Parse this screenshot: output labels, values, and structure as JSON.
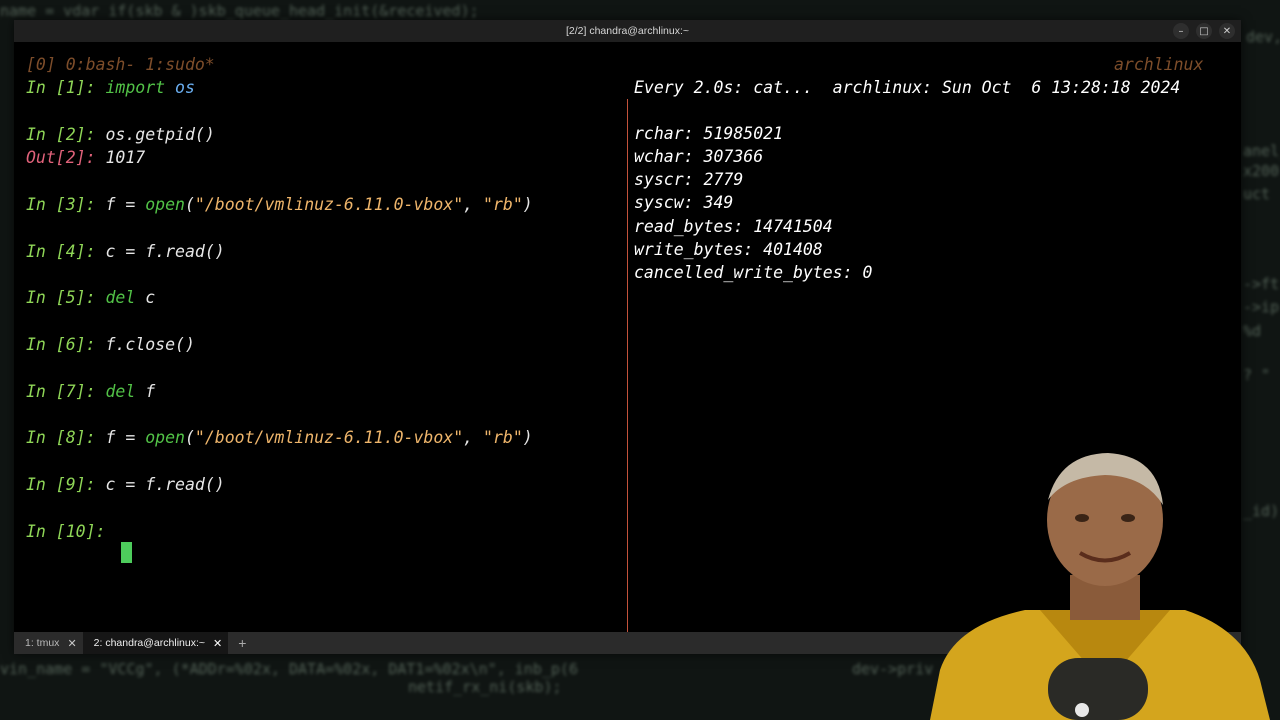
{
  "window": {
    "title": "[2/2] chandra@archlinux:~",
    "controls": [
      "minimize-icon",
      "maximize-icon",
      "close-icon"
    ]
  },
  "tmux": {
    "windows_status": "[0] 0:bash- 1:sudo*",
    "hostname": "archlinux"
  },
  "ipython": [
    {
      "prompt": "In [1]:",
      "code": [
        [
          "kw",
          "import"
        ],
        [
          "plain",
          " "
        ],
        [
          "mod",
          "os"
        ]
      ]
    },
    {
      "prompt": "In [2]:",
      "code": [
        [
          "plain",
          "os.getpid()"
        ]
      ]
    },
    {
      "prompt": "Out[2]:",
      "output": "1017"
    },
    {
      "prompt": "In [3]:",
      "code": [
        [
          "plain",
          "f = "
        ],
        [
          "bi",
          "open"
        ],
        [
          "plain",
          "("
        ],
        [
          "str",
          "\"/boot/vmlinuz-6.11.0-vbox\""
        ],
        [
          "plain",
          ", "
        ],
        [
          "str",
          "\"rb\""
        ],
        [
          "plain",
          ")"
        ]
      ]
    },
    {
      "prompt": "In [4]:",
      "code": [
        [
          "plain",
          "c = f.read()"
        ]
      ]
    },
    {
      "prompt": "In [5]:",
      "code": [
        [
          "kw",
          "del"
        ],
        [
          "plain",
          " c"
        ]
      ]
    },
    {
      "prompt": "In [6]:",
      "code": [
        [
          "plain",
          "f.close()"
        ]
      ]
    },
    {
      "prompt": "In [7]:",
      "code": [
        [
          "kw",
          "del"
        ],
        [
          "plain",
          " f"
        ]
      ]
    },
    {
      "prompt": "In [8]:",
      "code": [
        [
          "plain",
          "f = "
        ],
        [
          "bi",
          "open"
        ],
        [
          "plain",
          "("
        ],
        [
          "str",
          "\"/boot/vmlinuz-6.11.0-vbox\""
        ],
        [
          "plain",
          ", "
        ],
        [
          "str",
          "\"rb\""
        ],
        [
          "plain",
          ")"
        ]
      ]
    },
    {
      "prompt": "In [9]:",
      "code": [
        [
          "plain",
          "c = f.read()"
        ]
      ]
    },
    {
      "prompt": "In [10]:",
      "code": []
    }
  ],
  "watch": {
    "header": "Every 2.0s: cat...  archlinux: Sun Oct  6 13:28:18 2024",
    "lines": [
      "rchar: 51985021",
      "wchar: 307366",
      "syscr: 2779",
      "syscw: 349",
      "read_bytes: 14741504",
      "write_bytes: 401408",
      "cancelled_write_bytes: 0"
    ]
  },
  "tabs": [
    {
      "label": "1: tmux",
      "active": false
    },
    {
      "label": "2: chandra@archlinux:~",
      "active": true
    }
  ],
  "new_tab_label": "+",
  "backdrop_code": [
    "name = vdar     if(skb & )skb_queue_head_init(&received);",
    "dev,",
    "anel_",
    "x200",
    "uct",
    "->ft",
    "->ip",
    "%d",
    "? \"",
    "_id)",
    "vin_name = \"VCCg\", (*ADDr=%02x, DATA=%02x, DAT1=%02x\\n\", inb_p(6",
    "netif_rx_ni(skb);",
    "dev->priv"
  ]
}
